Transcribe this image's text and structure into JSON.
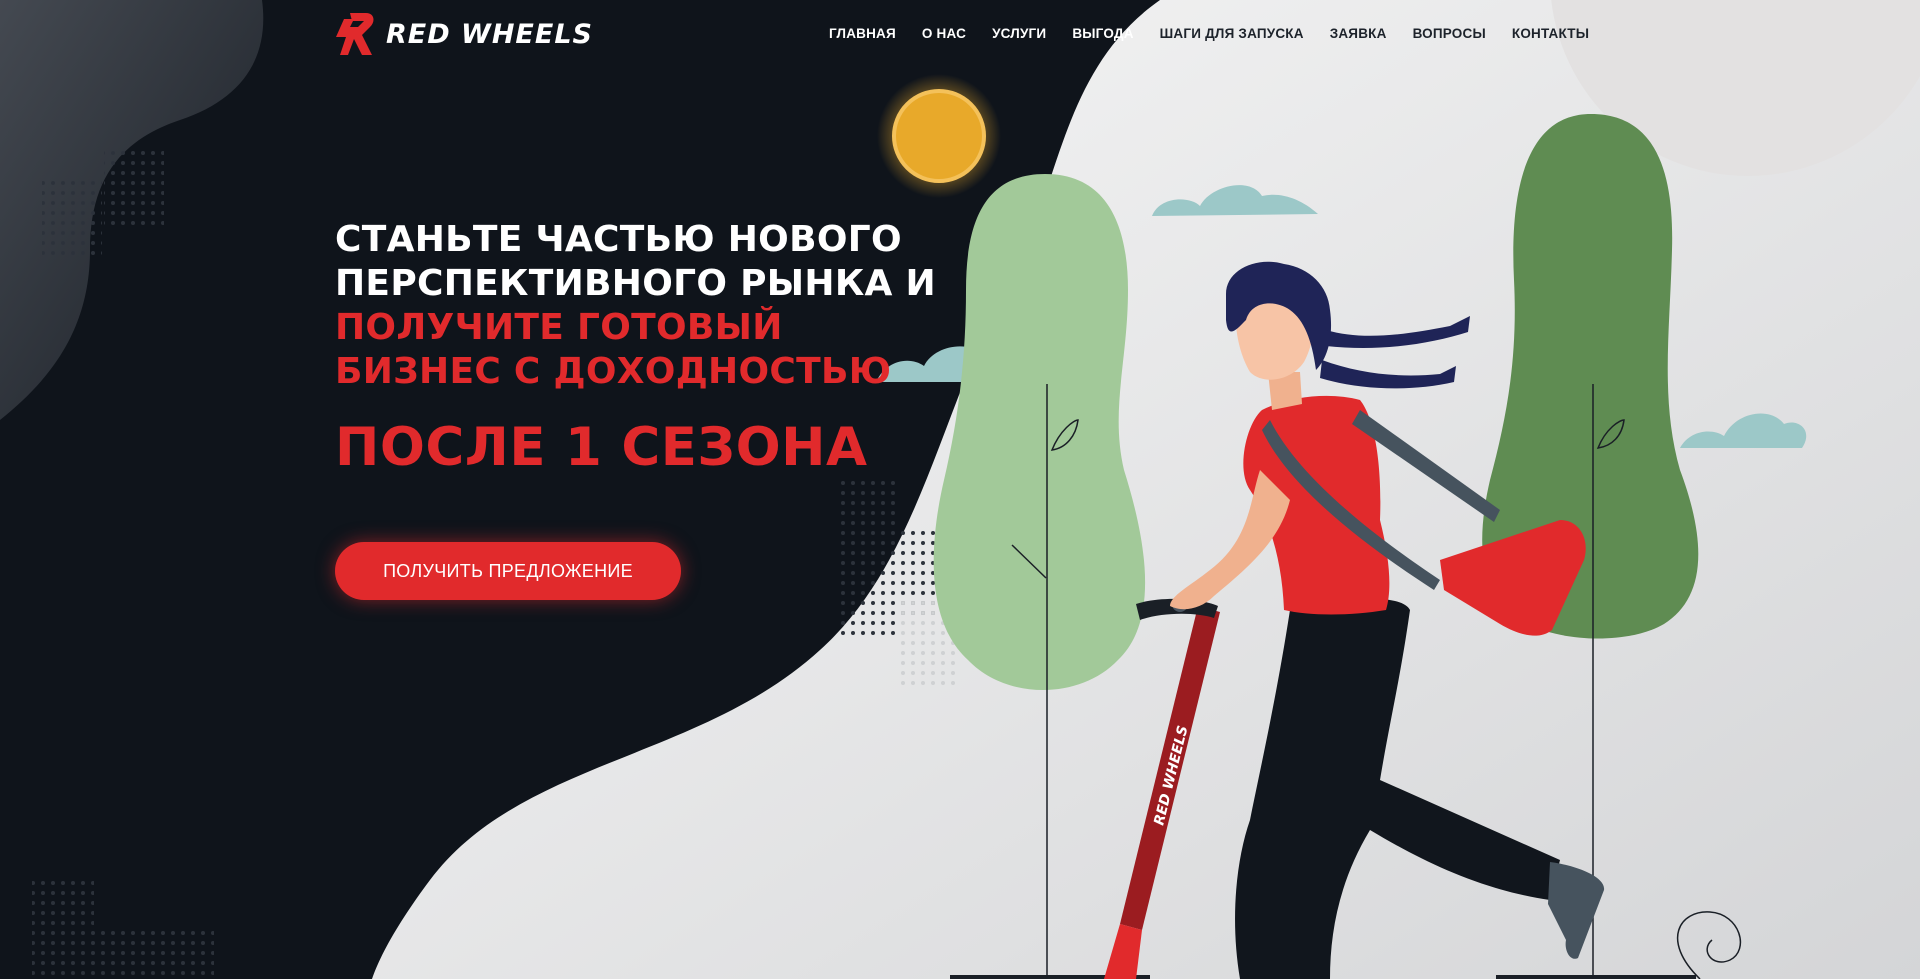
{
  "brand": {
    "name": "RED WHEELS",
    "accent_color": "#e12a2c",
    "logo_icon": "lightning-bolt-r-logo"
  },
  "nav": {
    "items": [
      {
        "label": "ГЛАВНАЯ"
      },
      {
        "label": "О НАС"
      },
      {
        "label": "УСЛУГИ"
      },
      {
        "label": "ВЫГОДА"
      },
      {
        "label": "ШАГИ ДЛЯ ЗАПУСКА"
      },
      {
        "label": "ЗАЯВКА"
      },
      {
        "label": "ВОПРОСЫ"
      },
      {
        "label": "КОНТАКТЫ"
      }
    ]
  },
  "hero": {
    "line1": "СТАНЬТЕ ЧАСТЬЮ НОВОГО",
    "line2": "ПЕРСПЕКТИВНОГО РЫНКА И",
    "line3": "ПОЛУЧИТЕ ГОТОВЫЙ",
    "line4": "БИЗНЕС С ДОХОДНОСТЬЮ",
    "highlight": "ПОСЛЕ 1 СЕЗОНА",
    "cta_label": "ПОЛУЧИТЬ ПРЕДЛОЖЕНИЕ"
  },
  "illustration": {
    "scooter_label": "RED WHEELS",
    "elements": [
      "sun-icon",
      "cloud-icon",
      "tree-icon",
      "woman-on-scooter"
    ]
  },
  "colors": {
    "dark_bg": "#0f141b",
    "light_bg": "#eceded",
    "sun": "#e8a92a",
    "tree_light": "#a2c999",
    "tree_dark": "#5f8c52",
    "cloud": "#9cc8c8"
  }
}
